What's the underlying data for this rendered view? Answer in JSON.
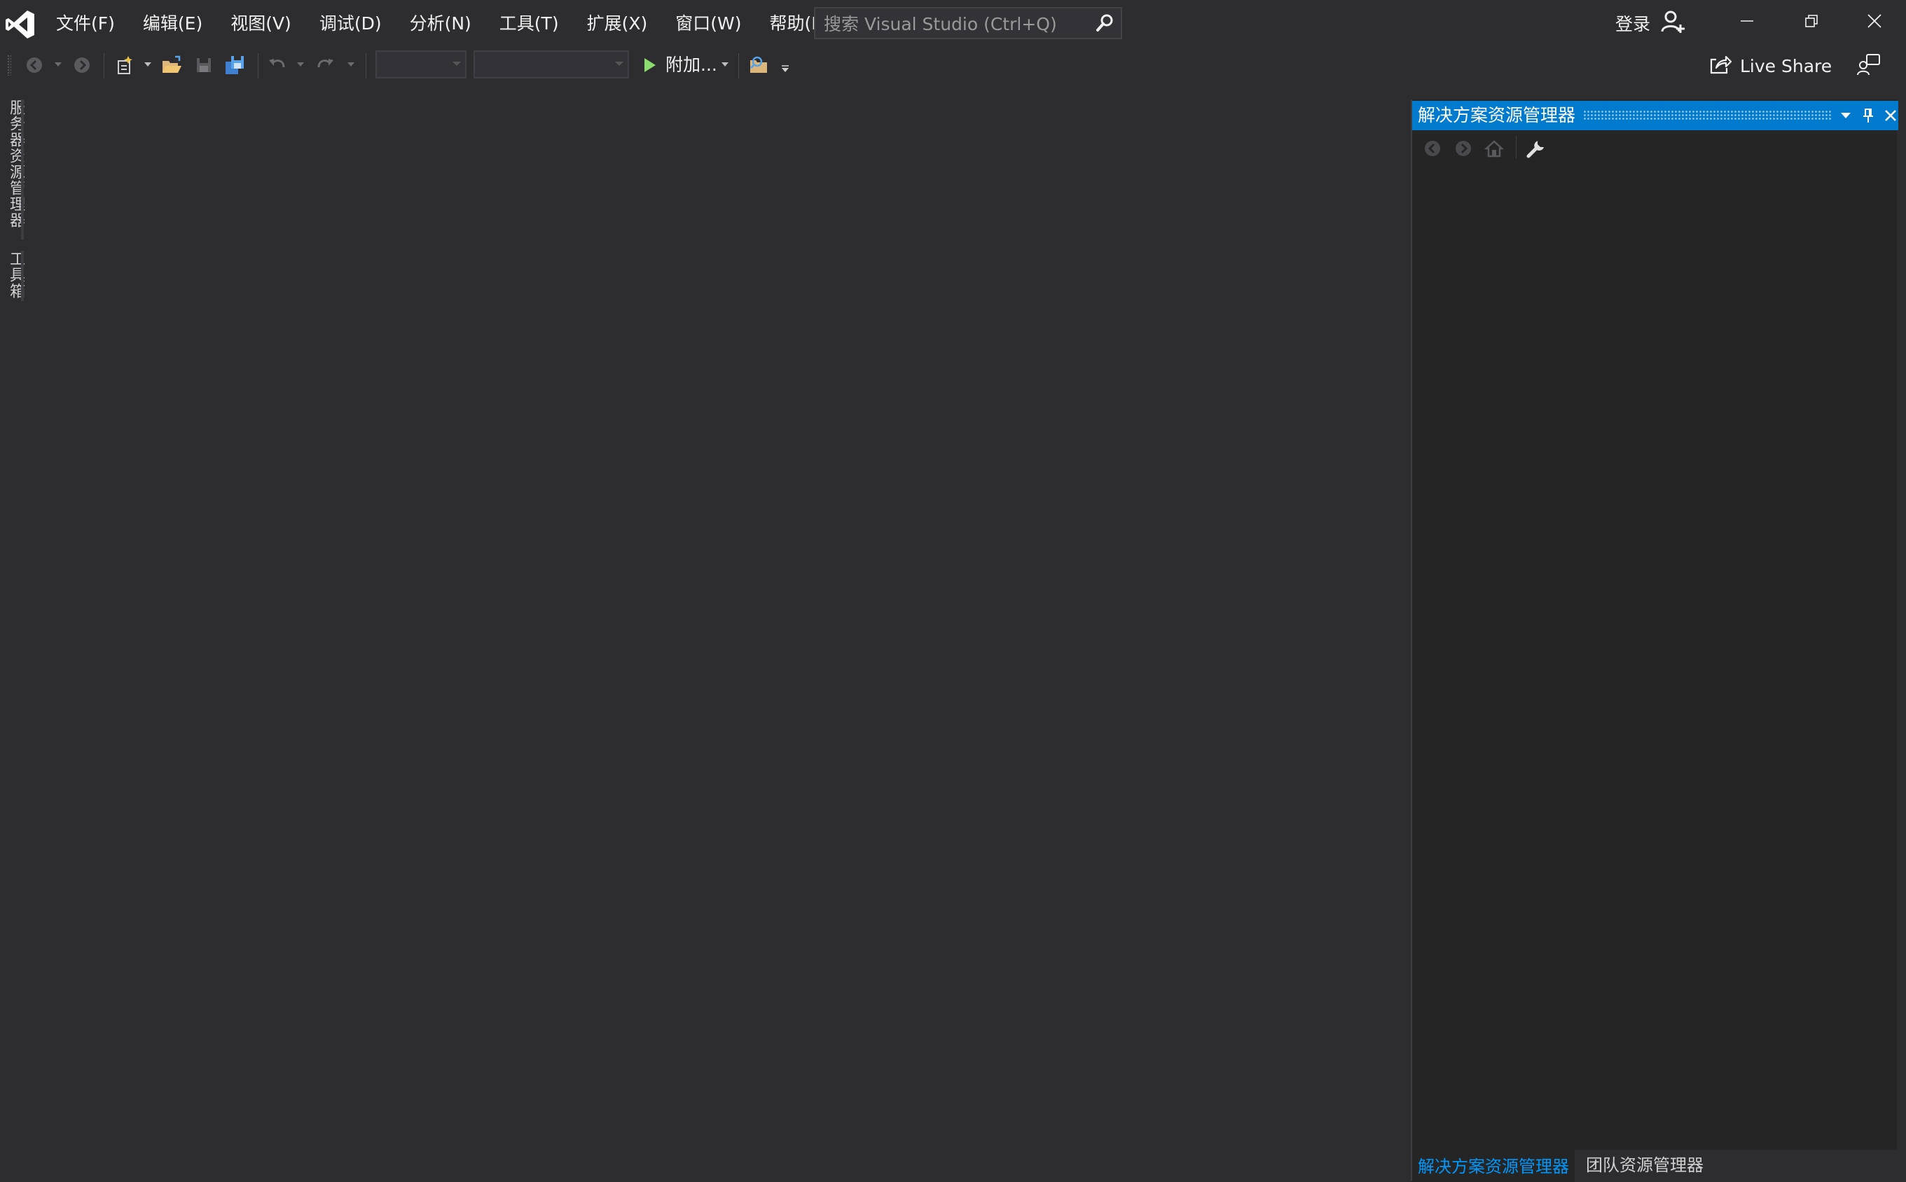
{
  "app": {
    "logo_icon": "visual-studio-logo-icon",
    "accent_color": "#007acc"
  },
  "menu": {
    "items": [
      "文件(F)",
      "编辑(E)",
      "视图(V)",
      "调试(D)",
      "分析(N)",
      "工具(T)",
      "扩展(X)",
      "窗口(W)",
      "帮助(H)"
    ]
  },
  "search": {
    "placeholder": "搜索 Visual Studio (Ctrl+Q)",
    "value": ""
  },
  "account": {
    "signin_label": "登录"
  },
  "window_controls": [
    "minimize-icon",
    "restore-icon",
    "close-icon"
  ],
  "toolbar": {
    "attach_label": "附加...",
    "config_combo_value": "",
    "platform_combo_value": "",
    "icons": [
      "back-icon",
      "forward-icon",
      "new-project-icon",
      "open-file-icon",
      "save-icon",
      "save-all-icon",
      "undo-icon",
      "redo-icon",
      "start-icon",
      "find-in-files-icon"
    ]
  },
  "live_share": {
    "label": "Live Share"
  },
  "left_strip": {
    "tabs": [
      "服务器资源管理器",
      "工具箱"
    ]
  },
  "solution_explorer": {
    "title": "解决方案资源管理器",
    "toolbar_icons": [
      "back-icon",
      "forward-icon",
      "home-icon",
      "properties-wrench-icon"
    ],
    "bottom_tabs": [
      "解决方案资源管理器",
      "团队资源管理器"
    ],
    "active_tab_color": "#0097fb"
  }
}
